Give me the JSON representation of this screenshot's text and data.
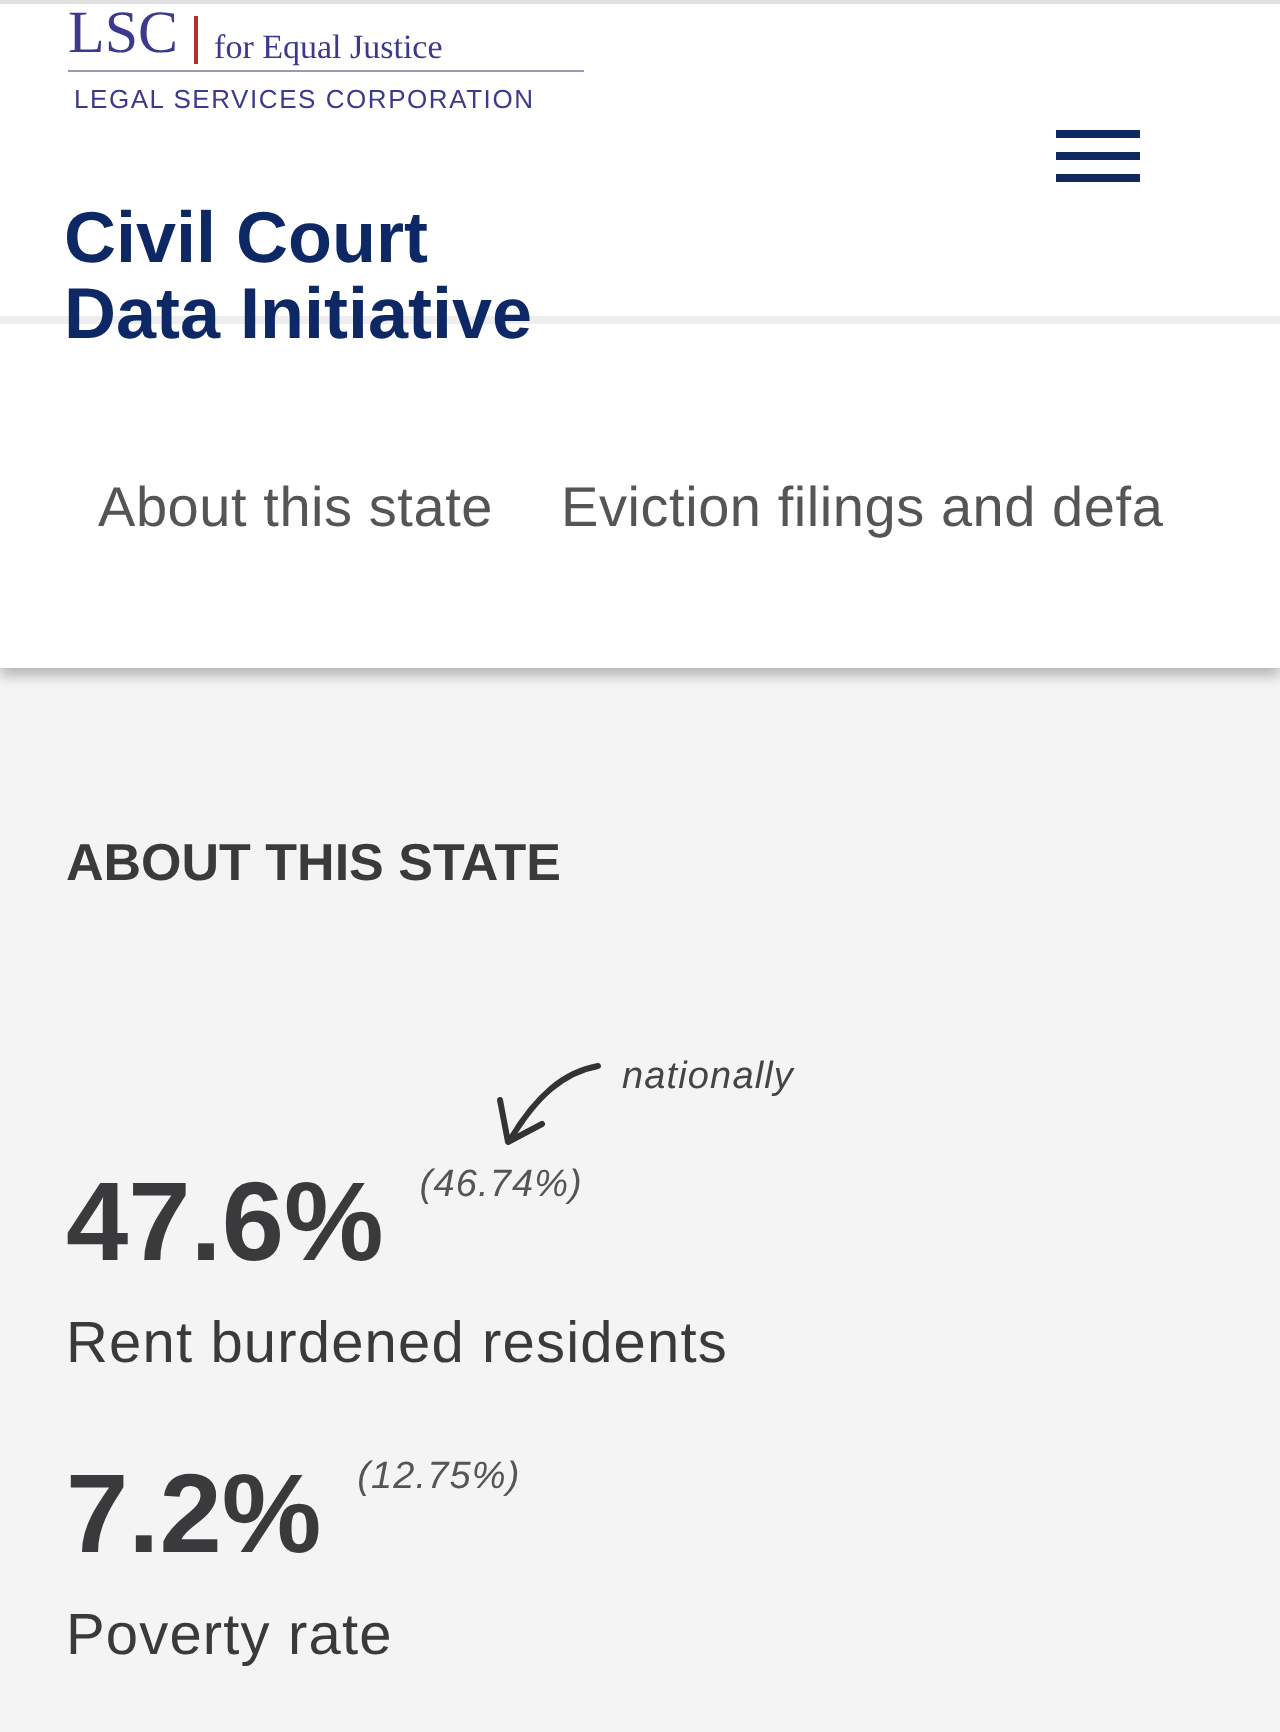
{
  "logo": {
    "mark": "LSC",
    "tagline": "for Equal Justice",
    "name": "LEGAL SERVICES CORPORATION"
  },
  "site_title": [
    "Civil Court",
    "Data Initiative"
  ],
  "tabs": [
    {
      "label": "About this state"
    },
    {
      "label": "Eviction filings and defa"
    }
  ],
  "section": {
    "heading": "ABOUT THIS STATE",
    "annotation": "nationally",
    "stats": [
      {
        "value": "47.6%",
        "national": "(46.74%)",
        "label": "Rent burdened residents"
      },
      {
        "value": "7.2%",
        "national": "(12.75%)",
        "label": "Poverty rate"
      }
    ]
  }
}
